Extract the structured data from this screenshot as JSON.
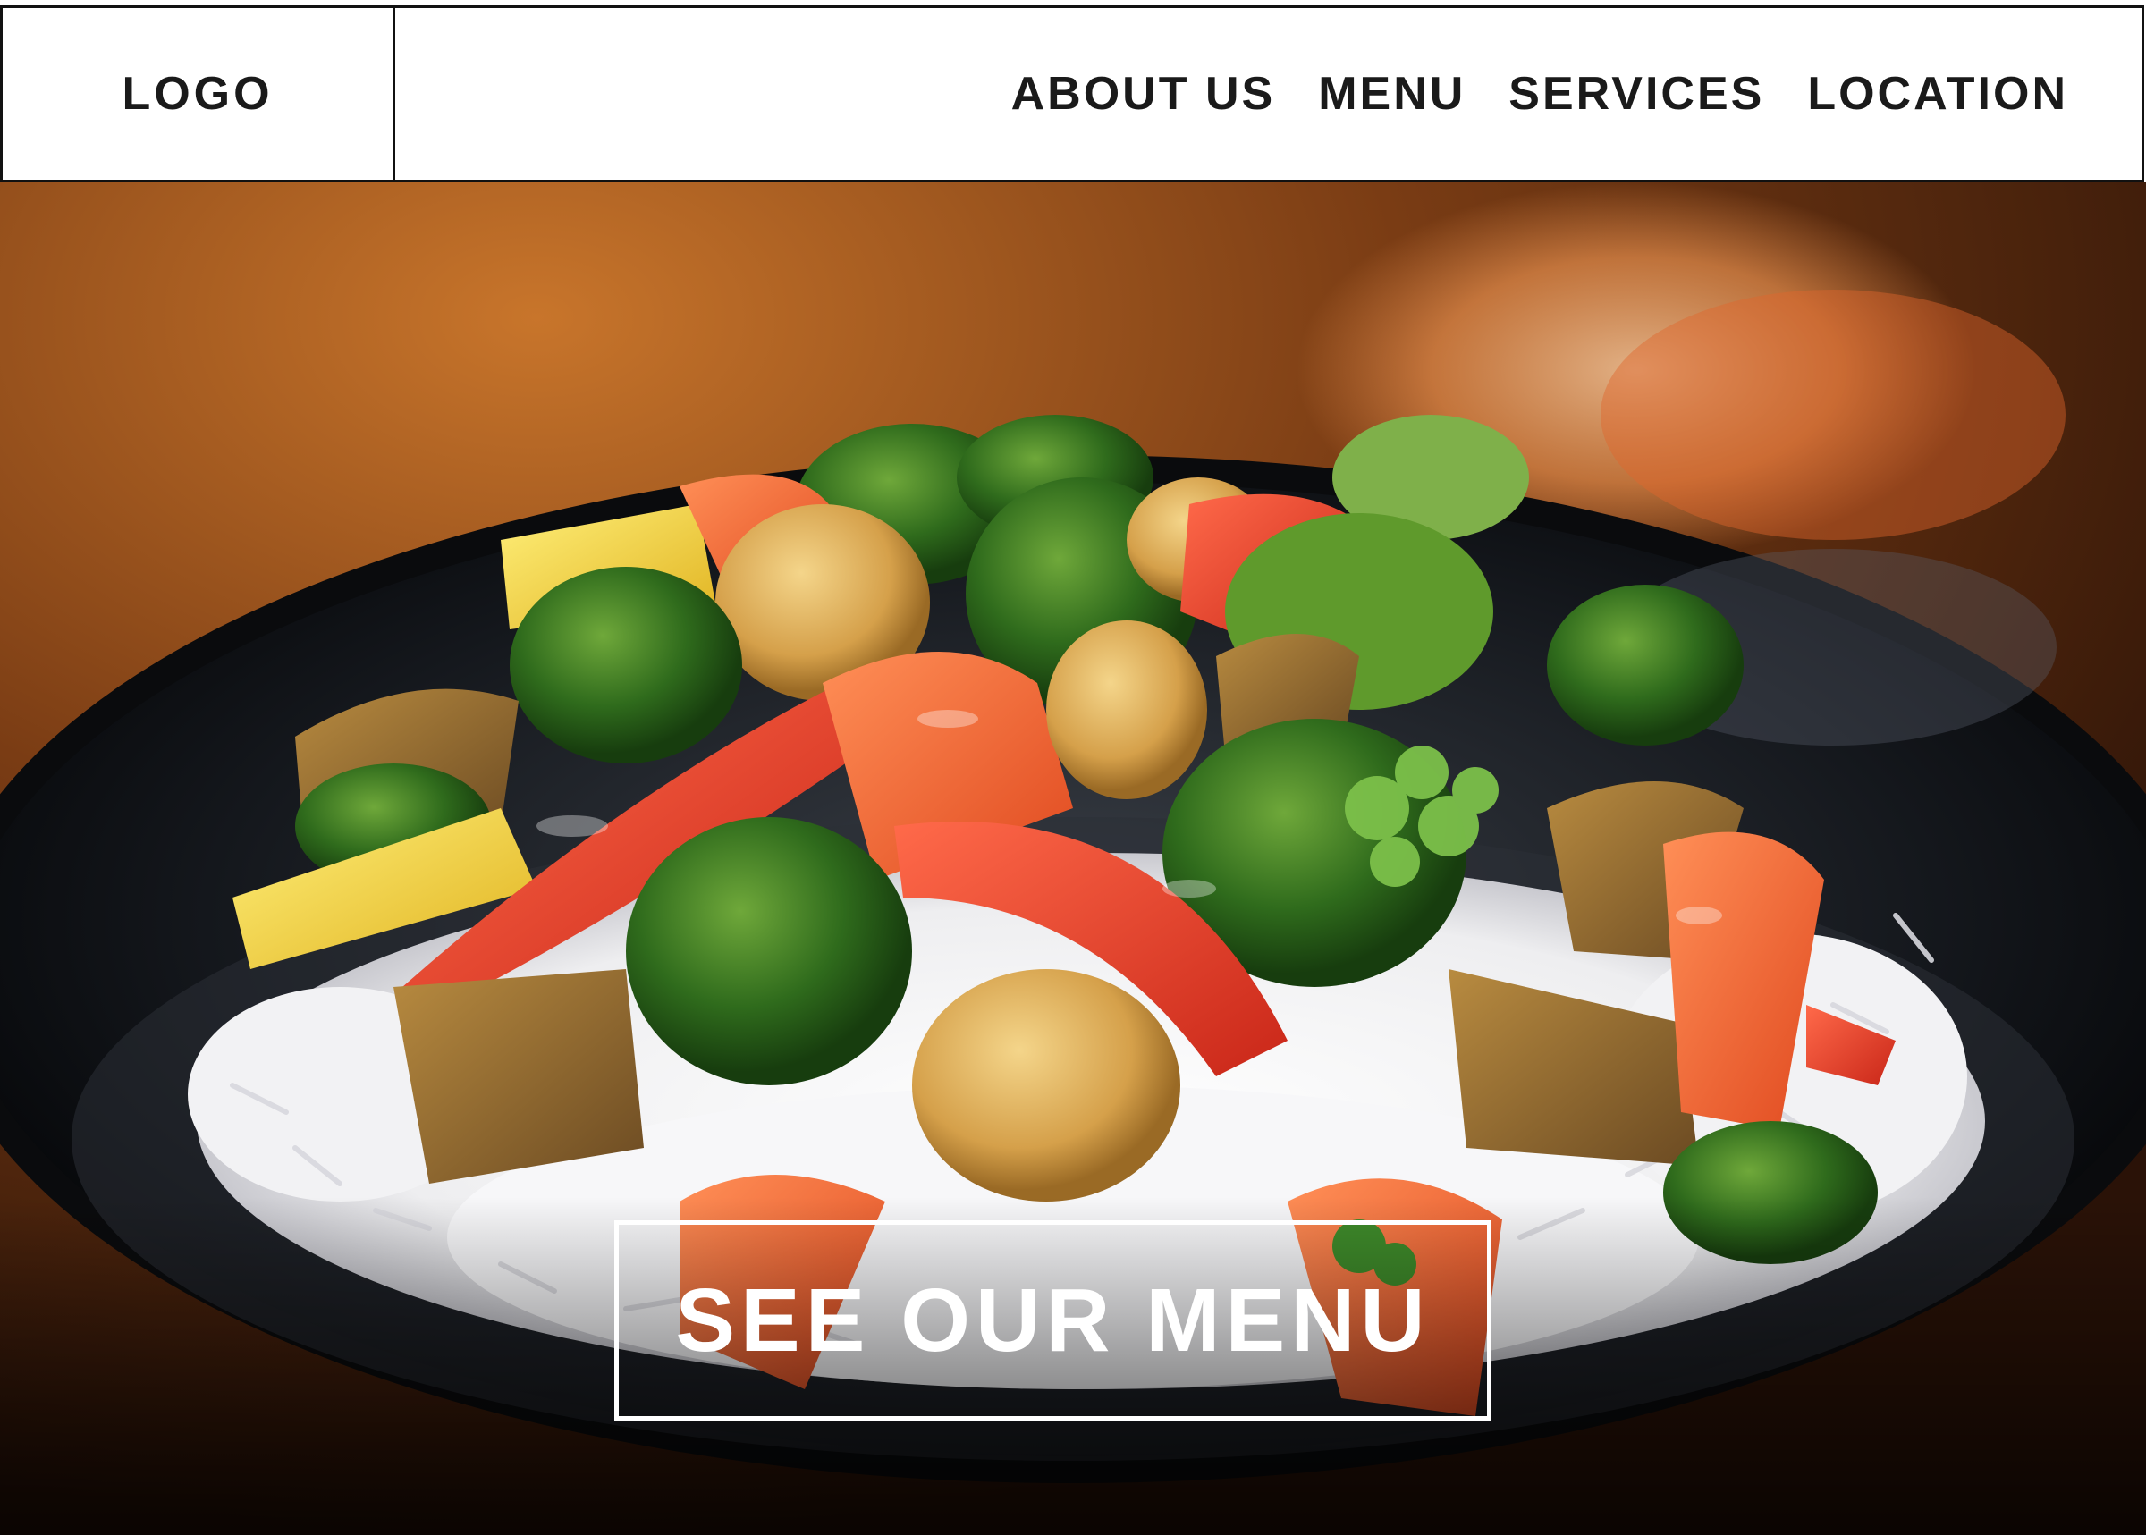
{
  "header": {
    "logo_label": "LOGO",
    "nav": [
      {
        "label": "ABOUT US"
      },
      {
        "label": "MENU"
      },
      {
        "label": "SERVICES"
      },
      {
        "label": "LOCATION"
      }
    ]
  },
  "hero": {
    "image": "stir-fry-vegetables-on-rice-photo",
    "cta_label": "SEE OUR MENU"
  },
  "colors": {
    "border": "#111111",
    "text": "#1a1a1a",
    "cta": "#ffffff"
  }
}
